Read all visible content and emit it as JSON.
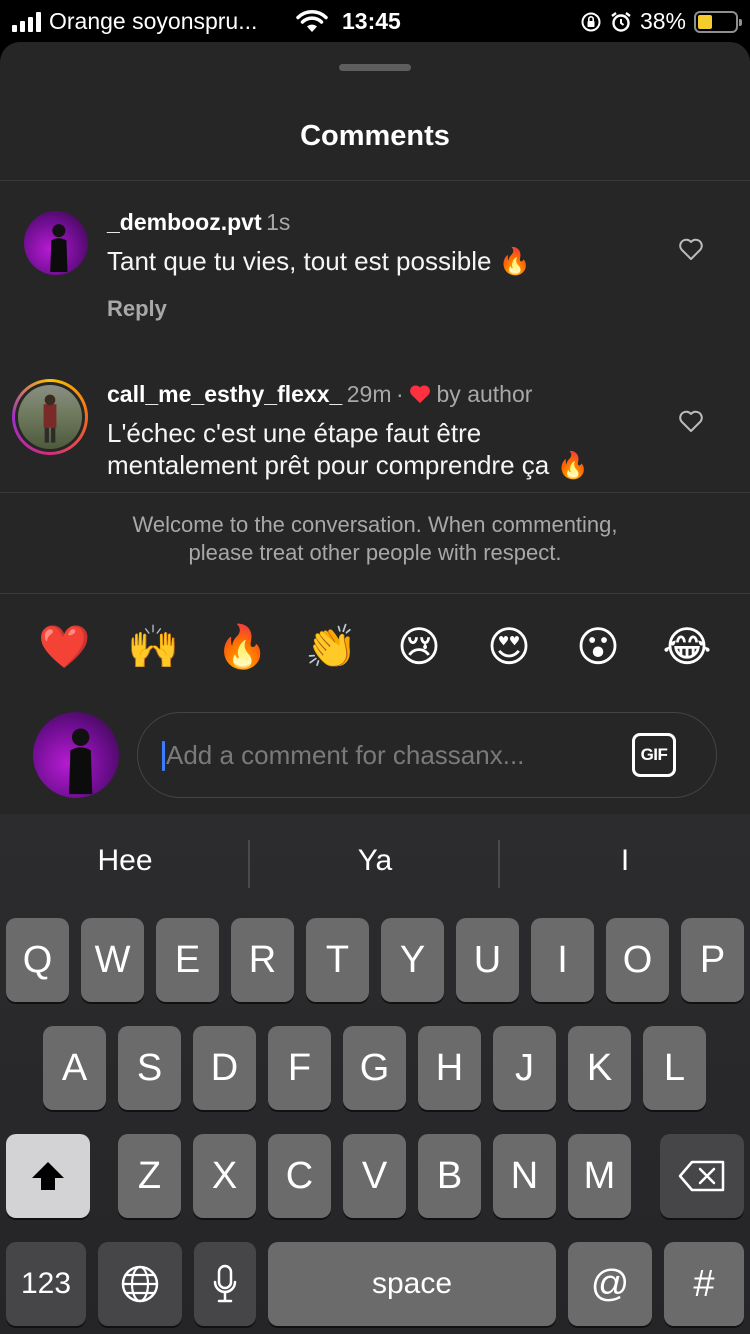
{
  "status_bar": {
    "carrier": "Orange soyonspru...",
    "time": "13:45",
    "battery_percent": "38%",
    "battery_level": 0.38,
    "battery_color": "#f5cc2e"
  },
  "sheet": {
    "title": "Comments"
  },
  "comments": [
    {
      "username": "_dembooz.pvt",
      "age": "1s",
      "text": "Tant que tu vies, tout est possible 🔥",
      "reply_label": "Reply",
      "liked_by_author": false
    },
    {
      "username": "call_me_esthy_flexx_",
      "age": "29m",
      "separator": "·",
      "author_like_label": "by author",
      "text": "L'échec c'est une étape faut être mentalement prêt pour comprendre ça 🔥",
      "liked_by_author": true,
      "heart_color": "#ff3040"
    }
  ],
  "notice": {
    "line1": "Welcome to the conversation. When commenting,",
    "line2": "please treat other people with respect."
  },
  "quick_reactions": [
    "❤️",
    "🙌",
    "🔥",
    "👏",
    "😢",
    "😍",
    "😮",
    "😂"
  ],
  "composer": {
    "placeholder": "Add a comment for chassanx...",
    "gif_label": "GIF",
    "caret_color": "#3d7cff"
  },
  "keyboard": {
    "suggestions": [
      "Hee",
      "Ya",
      "I"
    ],
    "row1": [
      "Q",
      "W",
      "E",
      "R",
      "T",
      "Y",
      "U",
      "I",
      "O",
      "P"
    ],
    "row2": [
      "A",
      "S",
      "D",
      "F",
      "G",
      "H",
      "J",
      "K",
      "L"
    ],
    "row3": [
      "Z",
      "X",
      "C",
      "V",
      "B",
      "N",
      "M"
    ],
    "numbers_label": "123",
    "space_label": "space",
    "at_label": "@",
    "hash_label": "#",
    "shift_icon": "shift-icon",
    "backspace_icon": "backspace-icon",
    "globe_icon": "globe-icon",
    "mic_icon": "microphone-icon"
  }
}
